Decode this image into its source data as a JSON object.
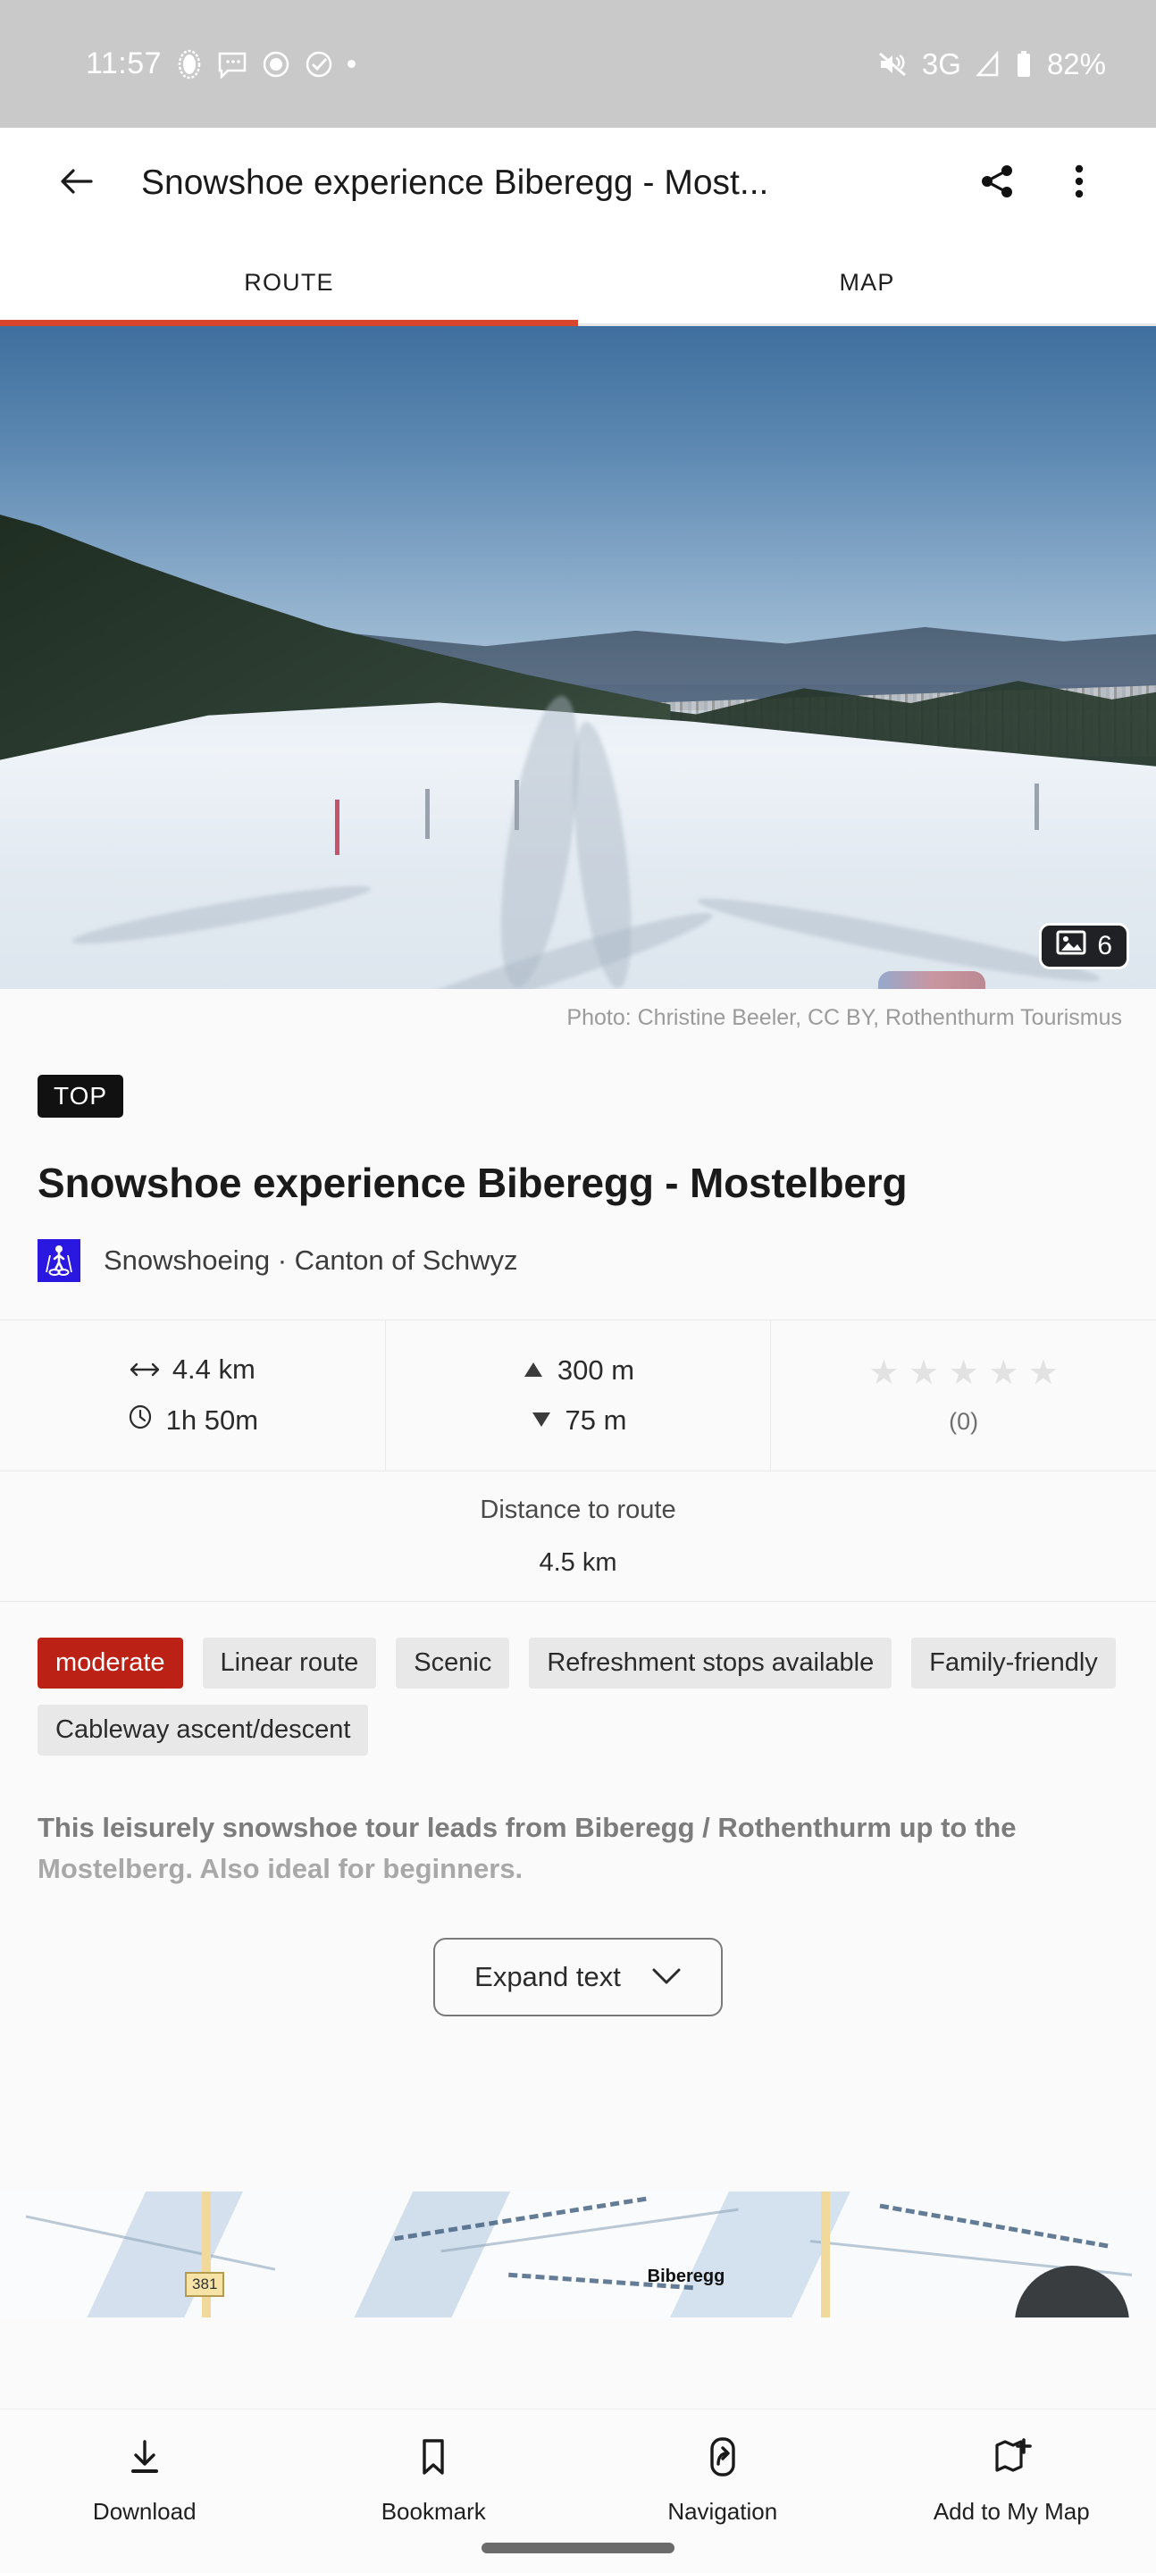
{
  "status_bar": {
    "time": "11:57",
    "left_icons": [
      "notification-oval-icon",
      "message-icon",
      "app-circle-icon",
      "check-circle-icon",
      "small-dot-icon"
    ],
    "mute_icon": "volume-off-icon",
    "network": "3G",
    "signal_icon": "signal-triangle-icon",
    "battery_icon": "battery-icon",
    "battery": "82%"
  },
  "toolbar": {
    "back_icon": "arrow-back-icon",
    "title": "Snowshoe experience Biberegg - Most...",
    "share_icon": "share-icon",
    "overflow_icon": "more-vertical-icon"
  },
  "tabs": {
    "items": [
      {
        "label": "ROUTE",
        "active": true
      },
      {
        "label": "MAP",
        "active": false
      }
    ],
    "active_color": "#d9452c"
  },
  "hero": {
    "photo_count": "6",
    "photo_icon": "image-icon",
    "credit": "Photo: Christine Beeler, CC BY, Rothenthurm Tourismus"
  },
  "detail": {
    "badge": "TOP",
    "title": "Snowshoe experience Biberegg - Mostelberg",
    "category_icon": "snowshoeing-icon",
    "category_line": "Snowshoeing · Canton of Schwyz"
  },
  "stats": {
    "distance_icon": "distance-arrows-icon",
    "distance": "4.4 km",
    "duration_icon": "clock-icon",
    "duration": "1h 50m",
    "ascent_icon": "triangle-up-icon",
    "ascent": "300 m",
    "descent_icon": "triangle-down-icon",
    "descent": "75 m",
    "stars": "★ ★ ★ ★ ★",
    "rating_count": "(0)"
  },
  "distance_to_route": {
    "label": "Distance to route",
    "value": "4.5 km"
  },
  "chips": [
    {
      "label": "moderate",
      "kind": "difficulty",
      "color": "#bc2116"
    },
    {
      "label": "Linear route",
      "kind": "plain"
    },
    {
      "label": "Scenic",
      "kind": "plain"
    },
    {
      "label": "Refreshment stops available",
      "kind": "plain"
    },
    {
      "label": "Family-friendly",
      "kind": "plain"
    },
    {
      "label": "Cableway ascent/descent",
      "kind": "plain"
    }
  ],
  "description": {
    "line1": "This leisurely snowshoe tour leads from Biberegg / Rothenthurm up to the",
    "line2": "Mostelberg. Also ideal for beginners.",
    "expand_label": "Expand text",
    "expand_icon": "chevron-down-icon"
  },
  "map_preview": {
    "place_label": "Biberegg",
    "road_shield": "381",
    "fab_icon": "map-fab-icon"
  },
  "bottom_bar": {
    "items": [
      {
        "label": "Download",
        "icon": "download-icon"
      },
      {
        "label": "Bookmark",
        "icon": "bookmark-icon"
      },
      {
        "label": "Navigation",
        "icon": "navigation-arrow-icon"
      },
      {
        "label": "Add to My Map",
        "icon": "add-to-map-icon"
      }
    ]
  }
}
